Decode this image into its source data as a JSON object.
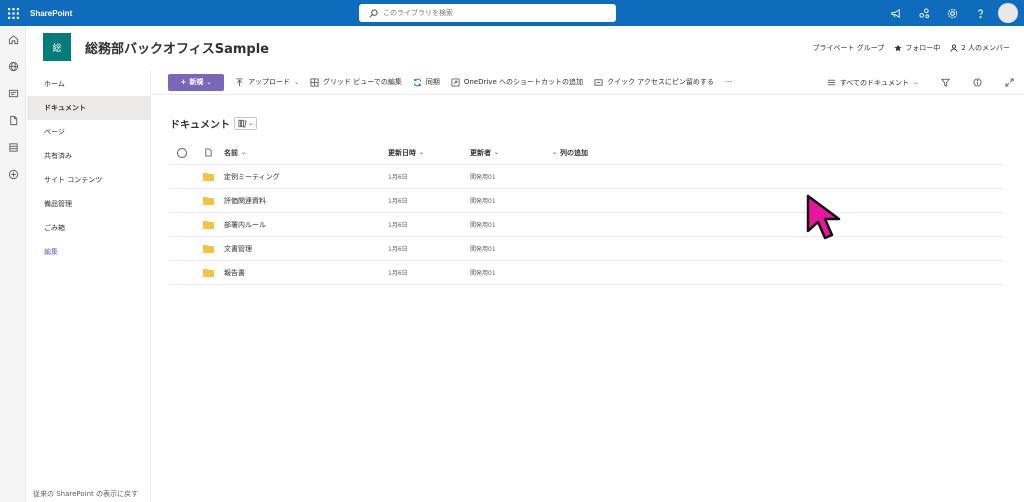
{
  "suite": {
    "app_name": "SharePoint",
    "search_placeholder": "このライブラリを検索",
    "icons": [
      "megaphone-icon",
      "share-icon",
      "gear-icon",
      "help-icon",
      "avatar"
    ]
  },
  "appbar": {
    "icons": [
      "home-icon",
      "globe-icon",
      "news-icon",
      "file-icon",
      "list-icon",
      "add-circle-icon"
    ]
  },
  "site": {
    "logo_text": "総",
    "title": "総務部バックオフィスSample",
    "privacy": "プライベート グループ",
    "follow": "フォロー中",
    "members": "2 人のメンバー",
    "logo_color": "#037c7b"
  },
  "nav": {
    "items": [
      {
        "label": "ホーム"
      },
      {
        "label": "ドキュメント"
      },
      {
        "label": "ページ"
      },
      {
        "label": "共有済み"
      },
      {
        "label": "サイト コンテンツ"
      },
      {
        "label": "備品管理"
      },
      {
        "label": "ごみ箱"
      },
      {
        "label": "編集"
      }
    ],
    "footer": "従来の SharePoint の表示に戻す"
  },
  "commands": {
    "new": "新規",
    "upload": "アップロード",
    "grid_edit": "グリッド ビューでの編集",
    "sync": "同期",
    "onedrive_shortcut": "OneDrive へのショートカットの追加",
    "pin_quick_access": "クイック アクセスにピン留めする",
    "more": "···",
    "view_name": "すべてのドキュメント",
    "accent": "#7b67b8"
  },
  "library": {
    "title": "ドキュメント",
    "columns": {
      "name": "名前",
      "modified": "更新日時",
      "modified_by": "更新者",
      "add_column": "列の追加"
    },
    "rows": [
      {
        "name": "定例ミーティング",
        "modified": "1月6日",
        "modified_by": "開発用01"
      },
      {
        "name": "評価関連資料",
        "modified": "1月6日",
        "modified_by": "開発用01"
      },
      {
        "name": "部署内ルール",
        "modified": "1月6日",
        "modified_by": "開発用01"
      },
      {
        "name": "文書管理",
        "modified": "1月6日",
        "modified_by": "開発用01"
      },
      {
        "name": "報告書",
        "modified": "1月6日",
        "modified_by": "開発用01"
      }
    ],
    "folder_color": "#f4c542"
  },
  "cursor_color": "#e8169a"
}
